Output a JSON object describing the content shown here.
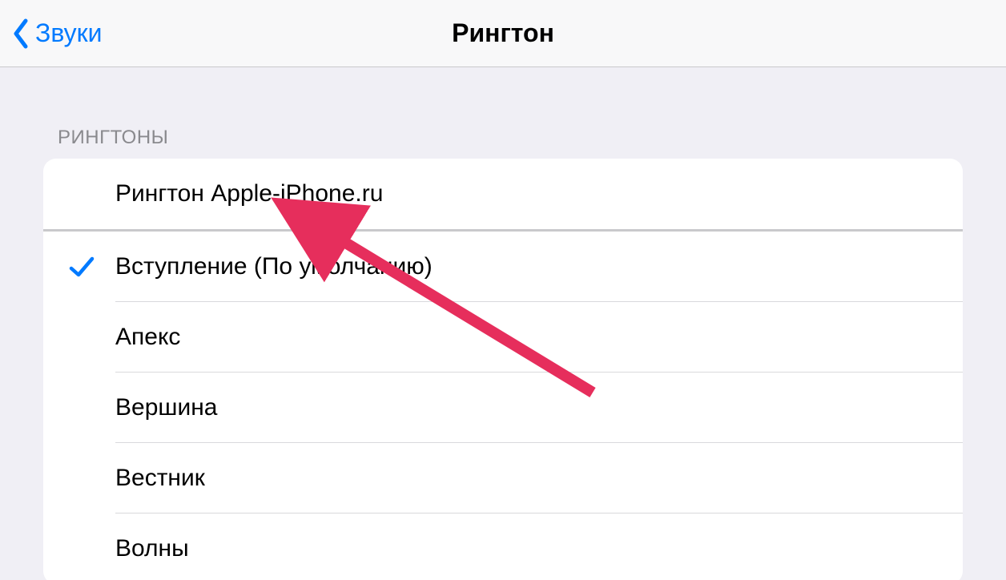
{
  "nav": {
    "back_label": "Звуки",
    "title": "Рингтон"
  },
  "section": {
    "header": "РИНГТОНЫ"
  },
  "custom_ringtones": [
    {
      "label": "Рингтон Apple-iPhone.ru",
      "selected": false
    }
  ],
  "system_ringtones": [
    {
      "label": "Вступление (По умолчанию)",
      "selected": true
    },
    {
      "label": "Апекс",
      "selected": false
    },
    {
      "label": "Вершина",
      "selected": false
    },
    {
      "label": "Вестник",
      "selected": false
    },
    {
      "label": "Волны",
      "selected": false
    }
  ],
  "annotation": {
    "color": "#e62e5c"
  }
}
